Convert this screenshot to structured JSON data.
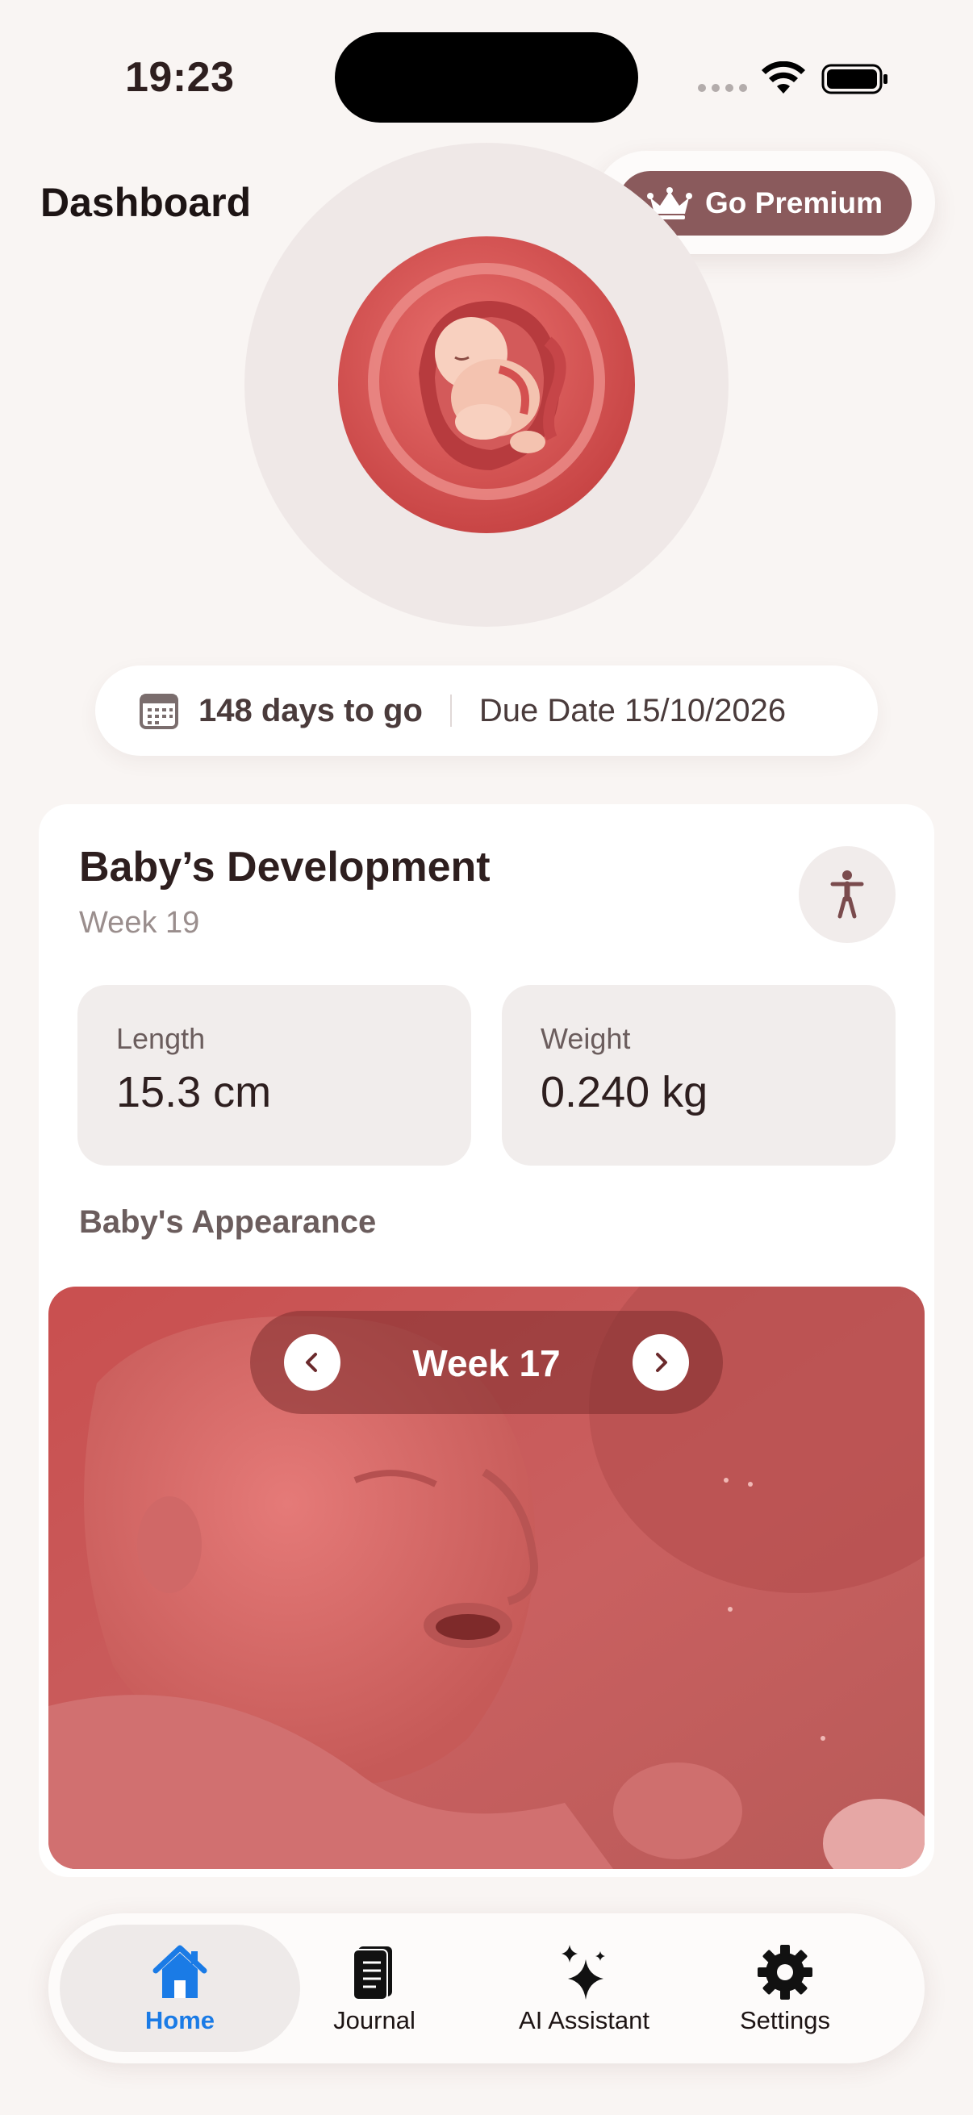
{
  "status_bar": {
    "time": "19:23"
  },
  "header": {
    "title": "Dashboard",
    "premium_label": "Go Premium"
  },
  "due": {
    "days_to_go": "148 days to go",
    "due_date": "Due Date 15/10/2026"
  },
  "development": {
    "title": "Baby’s Development",
    "week": "Week 19",
    "stats": [
      {
        "label": "Length",
        "value": "15.3 cm"
      },
      {
        "label": "Weight",
        "value": "0.240 kg"
      }
    ],
    "appearance_heading": "Baby's Appearance",
    "appearance_week": "Week 17"
  },
  "tabs": [
    {
      "label": "Home",
      "icon": "house-icon",
      "active": true
    },
    {
      "label": "Journal",
      "icon": "notebook-icon",
      "active": false
    },
    {
      "label": "AI Assistant",
      "icon": "sparkles-icon",
      "active": false
    },
    {
      "label": "Settings",
      "icon": "gear-icon",
      "active": false
    }
  ],
  "colors": {
    "background": "#f9f5f3",
    "premium_button": "#8a5a5c",
    "active_tab": "#1a7be6",
    "card_bg": "#ffffff",
    "stat_bg": "#f1edec"
  }
}
